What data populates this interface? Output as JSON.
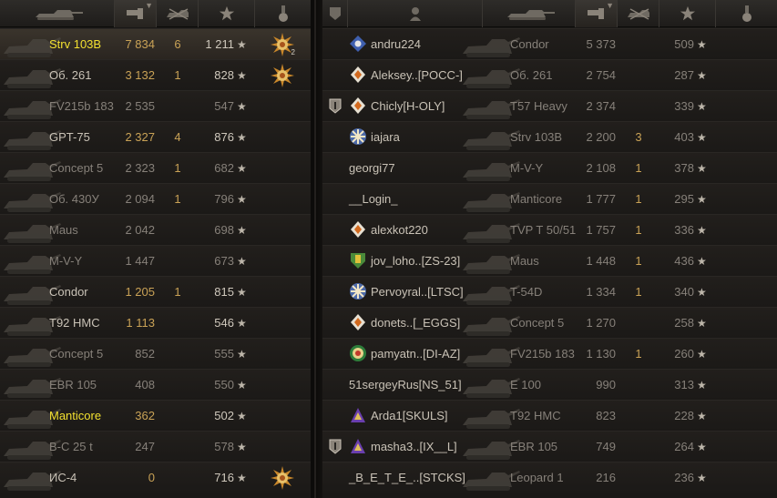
{
  "header_icons": {
    "left": [
      "tank-icon",
      "damage-icon",
      "kills-icon",
      "xp-star-icon",
      "medal-icon"
    ],
    "right": [
      "platoon-icon",
      "player-icon",
      "tank-icon",
      "damage-icon",
      "kills-icon",
      "xp-star-icon",
      "medal-icon"
    ]
  },
  "left_team": [
    {
      "tank": "Strv 103B",
      "damage": "7 834",
      "kills": "6",
      "xp": "1 211",
      "medal": "ace",
      "medal_count": "2",
      "highlight": true,
      "gold": true,
      "dim": false
    },
    {
      "tank": "Об. 261",
      "damage": "3 132",
      "kills": "1",
      "xp": "828",
      "medal": "ace",
      "medal_count": "",
      "highlight": false,
      "gold": false,
      "dim": false
    },
    {
      "tank": "FV215b 183",
      "damage": "2 535",
      "kills": "",
      "xp": "547",
      "medal": "",
      "medal_count": "",
      "highlight": false,
      "gold": false,
      "dim": true
    },
    {
      "tank": "GPT-75",
      "damage": "2 327",
      "kills": "4",
      "xp": "876",
      "medal": "",
      "medal_count": "",
      "highlight": false,
      "gold": false,
      "dim": false
    },
    {
      "tank": "Concept 5",
      "damage": "2 323",
      "kills": "1",
      "xp": "682",
      "medal": "",
      "medal_count": "",
      "highlight": false,
      "gold": false,
      "dim": true
    },
    {
      "tank": "Об. 430У",
      "damage": "2 094",
      "kills": "1",
      "xp": "796",
      "medal": "",
      "medal_count": "",
      "highlight": false,
      "gold": false,
      "dim": true
    },
    {
      "tank": "Maus",
      "damage": "2 042",
      "kills": "",
      "xp": "698",
      "medal": "",
      "medal_count": "",
      "highlight": false,
      "gold": false,
      "dim": true
    },
    {
      "tank": "M-V-Y",
      "damage": "1 447",
      "kills": "",
      "xp": "673",
      "medal": "",
      "medal_count": "",
      "highlight": false,
      "gold": false,
      "dim": true
    },
    {
      "tank": "Condor",
      "damage": "1 205",
      "kills": "1",
      "xp": "815",
      "medal": "",
      "medal_count": "",
      "highlight": false,
      "gold": false,
      "dim": false
    },
    {
      "tank": "T92 HMC",
      "damage": "1 113",
      "kills": "",
      "xp": "546",
      "medal": "",
      "medal_count": "",
      "highlight": false,
      "gold": false,
      "dim": false
    },
    {
      "tank": "Concept 5",
      "damage": "852",
      "kills": "",
      "xp": "555",
      "medal": "",
      "medal_count": "",
      "highlight": false,
      "gold": false,
      "dim": true
    },
    {
      "tank": "EBR 105",
      "damage": "408",
      "kills": "",
      "xp": "550",
      "medal": "",
      "medal_count": "",
      "highlight": false,
      "gold": false,
      "dim": true
    },
    {
      "tank": "Manticore",
      "damage": "362",
      "kills": "",
      "xp": "502",
      "medal": "",
      "medal_count": "",
      "highlight": false,
      "gold": true,
      "dim": false
    },
    {
      "tank": "B-C 25 t",
      "damage": "247",
      "kills": "",
      "xp": "578",
      "medal": "",
      "medal_count": "",
      "highlight": false,
      "gold": false,
      "dim": true
    },
    {
      "tank": "ИС-4",
      "damage": "0",
      "kills": "",
      "xp": "716",
      "medal": "ace",
      "medal_count": "",
      "highlight": false,
      "gold": false,
      "dim": false
    }
  ],
  "right_team": [
    {
      "platoon": false,
      "clan": "blue",
      "player": "andru224",
      "tank": "Condor",
      "damage": "5 373",
      "kills": "",
      "xp": "509",
      "dim": true
    },
    {
      "platoon": false,
      "clan": "orange",
      "player": "Aleksey..[POCC-]",
      "tank": "Об. 261",
      "damage": "2 754",
      "kills": "",
      "xp": "287",
      "dim": true
    },
    {
      "platoon": true,
      "clan": "orange",
      "player": "Chicly[H-OLY]",
      "tank": "T57 Heavy",
      "damage": "2 374",
      "kills": "",
      "xp": "339",
      "dim": true
    },
    {
      "platoon": false,
      "clan": "snow",
      "player": "iajara",
      "tank": "Strv 103B",
      "damage": "2 200",
      "kills": "3",
      "xp": "403",
      "dim": true
    },
    {
      "platoon": false,
      "clan": "",
      "player": "georgi77",
      "tank": "M-V-Y",
      "damage": "2 108",
      "kills": "1",
      "xp": "378",
      "dim": true
    },
    {
      "platoon": false,
      "clan": "",
      "player": "__Login_",
      "tank": "Manticore",
      "damage": "1 777",
      "kills": "1",
      "xp": "295",
      "dim": true
    },
    {
      "platoon": false,
      "clan": "orange",
      "player": "alexkot220",
      "tank": "TVP T 50/51",
      "damage": "1 757",
      "kills": "1",
      "xp": "336",
      "dim": true
    },
    {
      "platoon": false,
      "clan": "shield",
      "player": "jov_loho..[ZS-23]",
      "tank": "Maus",
      "damage": "1 448",
      "kills": "1",
      "xp": "436",
      "dim": true
    },
    {
      "platoon": false,
      "clan": "snow",
      "player": "Pervoyral..[LTSC]",
      "tank": "T-54D",
      "damage": "1 334",
      "kills": "1",
      "xp": "340",
      "dim": true
    },
    {
      "platoon": false,
      "clan": "orange",
      "player": "donets..[_EGGS]",
      "tank": "Concept 5",
      "damage": "1 270",
      "kills": "",
      "xp": "258",
      "dim": true
    },
    {
      "platoon": false,
      "clan": "round",
      "player": "pamyatn..[DI-AZ]",
      "tank": "FV215b 183",
      "damage": "1 130",
      "kills": "1",
      "xp": "260",
      "dim": true
    },
    {
      "platoon": false,
      "clan": "",
      "player": "51sergeyRus[NS_51]",
      "tank": "E 100",
      "damage": "990",
      "kills": "",
      "xp": "313",
      "dim": true
    },
    {
      "platoon": false,
      "clan": "purple",
      "player": "Arda1[SKULS]",
      "tank": "T92 HMC",
      "damage": "823",
      "kills": "",
      "xp": "228",
      "dim": true
    },
    {
      "platoon": true,
      "clan": "purple",
      "player": "masha3..[IX__L]",
      "tank": "EBR 105",
      "damage": "749",
      "kills": "",
      "xp": "264",
      "dim": true
    },
    {
      "platoon": false,
      "clan": "",
      "player": "_B_E_T_E_..[STCKS]",
      "tank": "Leopard 1",
      "damage": "216",
      "kills": "",
      "xp": "236",
      "dim": true
    }
  ],
  "colors": {
    "gold_text": "#f2e030",
    "value_text": "#c9a256",
    "dim_text": "#868079",
    "highlight_row": "#3a342c"
  }
}
